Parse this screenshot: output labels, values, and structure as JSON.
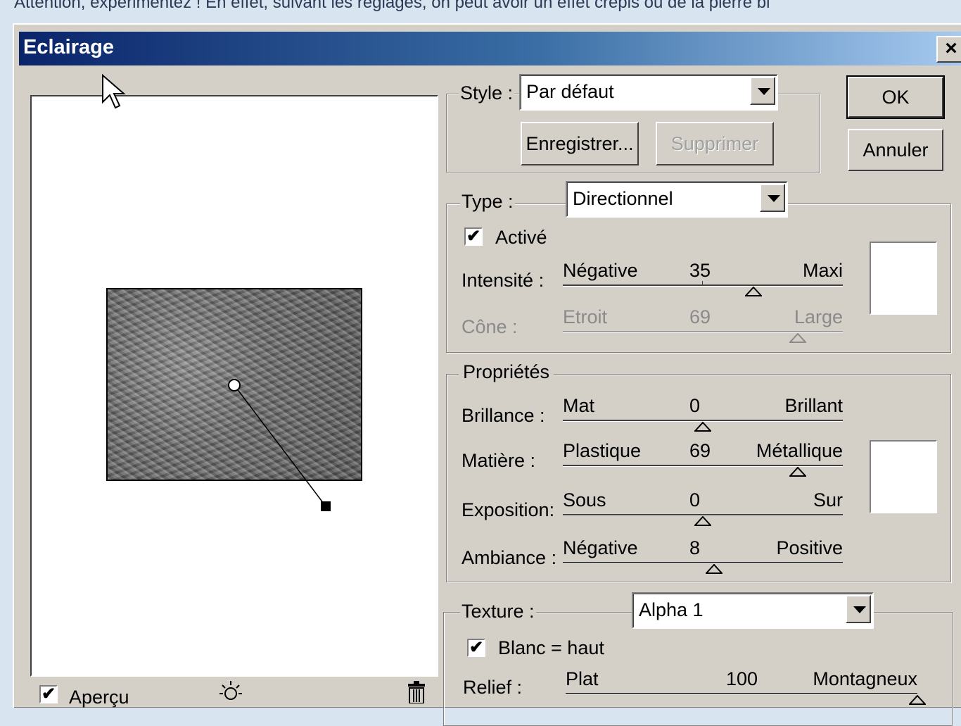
{
  "page_text": "Attention, expérimentez ! En effet, suivant les réglages, on peut avoir un effet crépis ou de la pierre bi",
  "dialog": {
    "title": "Eclairage",
    "close_label": "×",
    "ok_label": "OK",
    "cancel_label": "Annuler"
  },
  "style_group": {
    "label": "Style :",
    "value": "Par défaut",
    "save_label": "Enregistrer...",
    "delete_label": "Supprimer"
  },
  "type_group": {
    "label": "Type :",
    "value": "Directionnel",
    "active_label": "Activé",
    "active_checked": true,
    "intensity": {
      "label": "Intensité :",
      "low": "Négative",
      "value": "35",
      "high": "Maxi",
      "level": 0.68
    },
    "cone": {
      "label": "Cône :",
      "low": "Etroit",
      "value": "69",
      "high": "Large",
      "level": 0.84
    }
  },
  "properties_group": {
    "label": "Propriétés",
    "gloss": {
      "label": "Brillance :",
      "low": "Mat",
      "value": "0",
      "high": "Brillant",
      "level": 0.5
    },
    "material": {
      "label": "Matière :",
      "low": "Plastique",
      "value": "69",
      "high": "Métallique",
      "level": 0.84
    },
    "exposure": {
      "label": "Exposition:",
      "low": "Sous",
      "value": "0",
      "high": "Sur",
      "level": 0.5
    },
    "ambience": {
      "label": "Ambiance :",
      "low": "Négative",
      "value": "8",
      "high": "Positive",
      "level": 0.54
    }
  },
  "texture_group": {
    "label": "Texture :",
    "value": "Alpha 1",
    "white_high_label": "Blanc = haut",
    "white_high_checked": true,
    "relief": {
      "label": "Relief :",
      "low": "Plat",
      "value": "100",
      "high": "Montagneux",
      "level": 1.0
    }
  },
  "preview": {
    "checkbox_label": "Aperçu",
    "checked": true,
    "icons": [
      "light-bulb-icon",
      "trash-icon"
    ]
  },
  "colors": {
    "dialog_bg": "#d4d0c8",
    "title_start": "#0a246a",
    "title_end": "#a6caf0"
  }
}
